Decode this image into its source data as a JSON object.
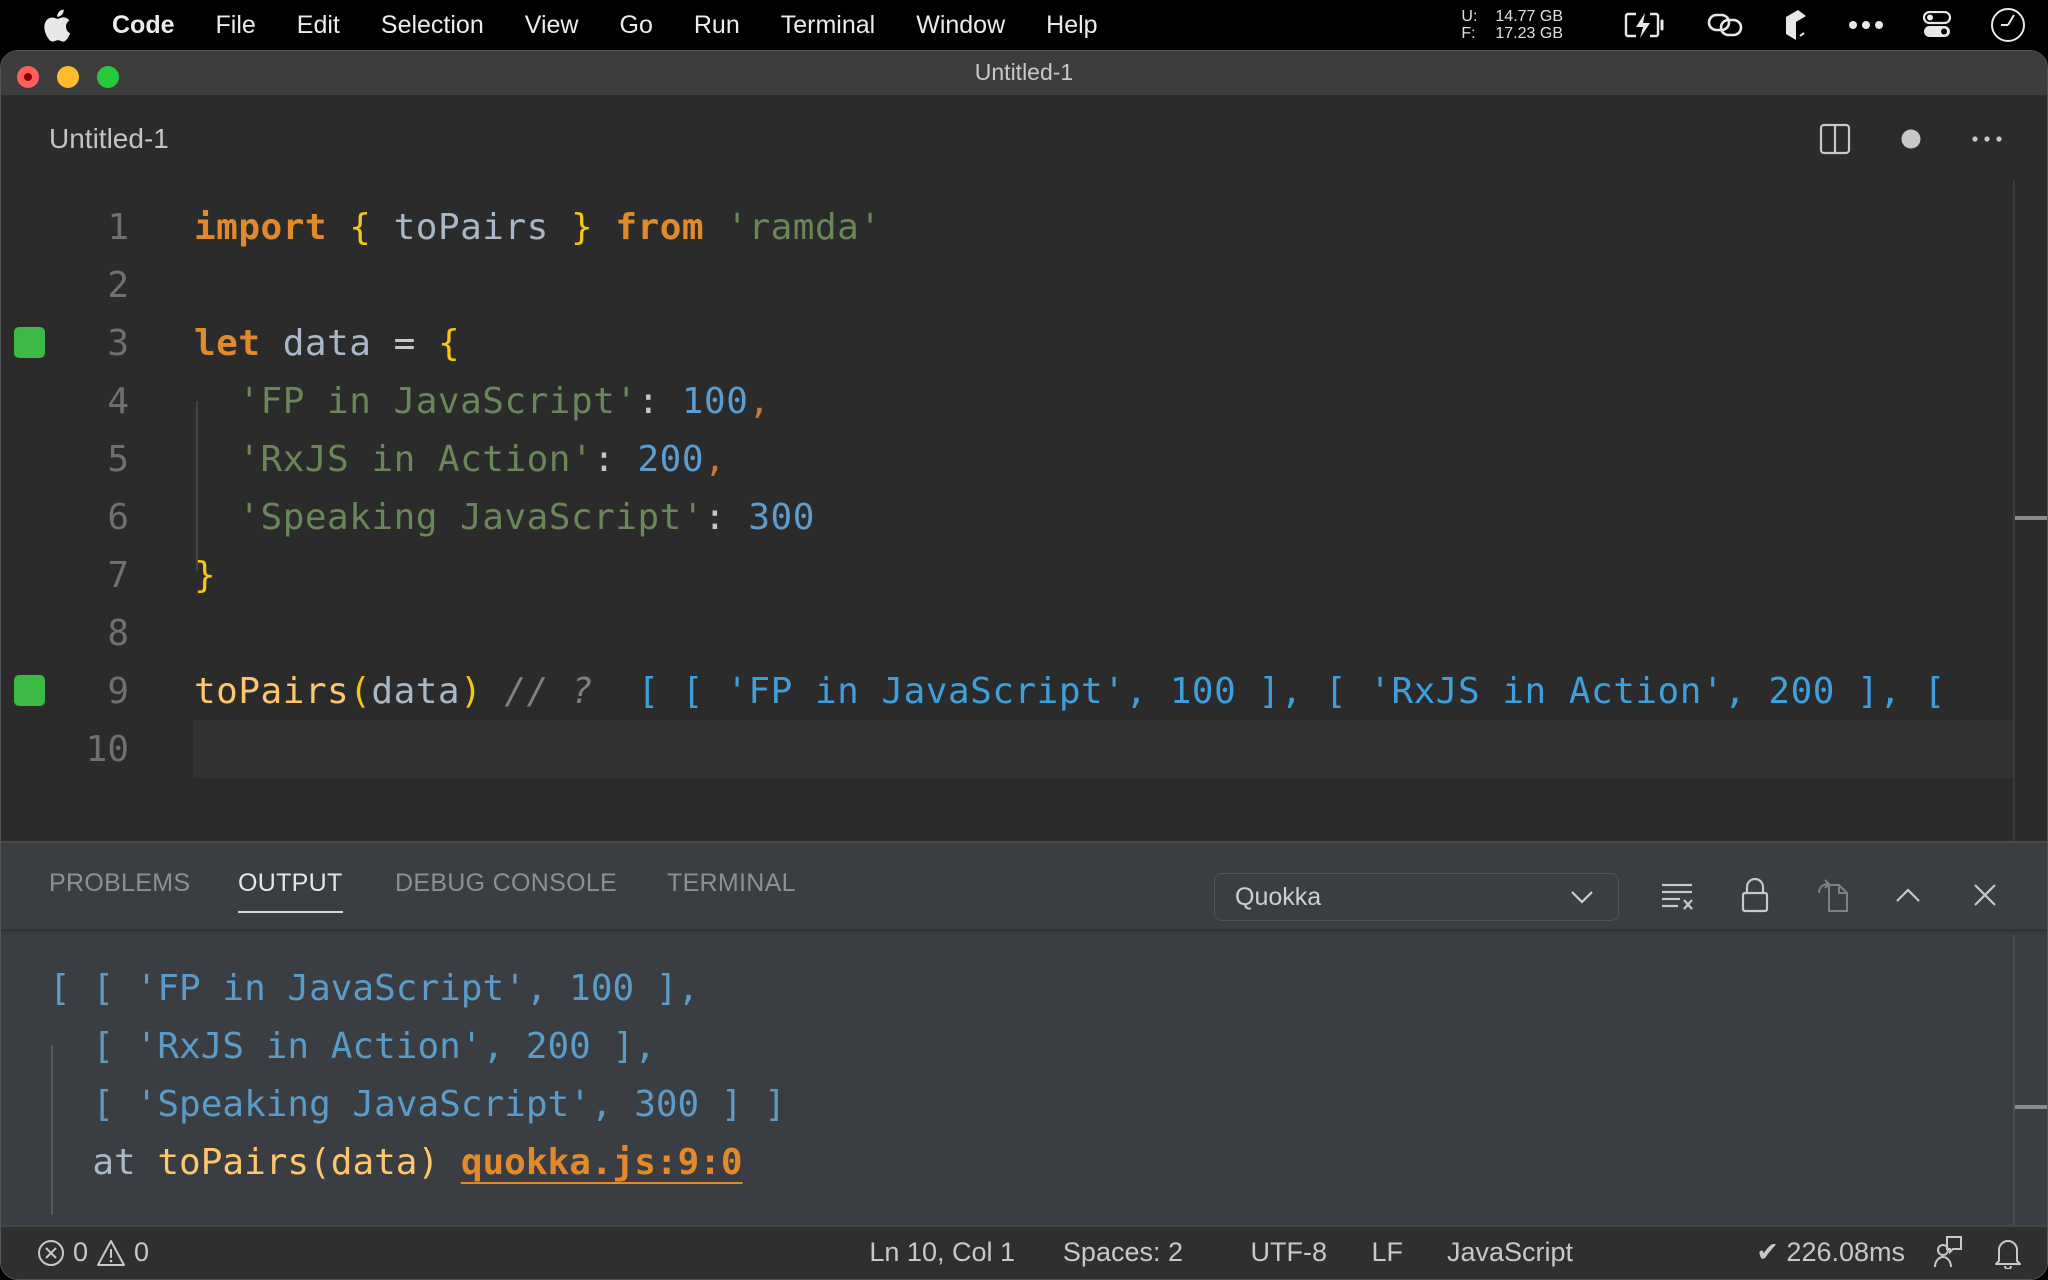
{
  "menubar": {
    "app_name": "Code",
    "items": [
      "File",
      "Edit",
      "Selection",
      "View",
      "Go",
      "Run",
      "Terminal",
      "Window",
      "Help"
    ],
    "memory": {
      "used_label": "U:",
      "used_value": "14.77 GB",
      "free_label": "F:",
      "free_value": "17.23 GB"
    },
    "status_icons": [
      "battery-charging-icon",
      "link-icon",
      "package-icon",
      "more-icon",
      "control-center-icon",
      "clock-icon"
    ]
  },
  "window": {
    "title": "Untitled-1"
  },
  "editor_tab": {
    "title": "Untitled-1",
    "actions": [
      "split-editor-icon",
      "unsaved-dot-icon",
      "more-actions-icon"
    ]
  },
  "editor": {
    "lines": [
      {
        "number": "1",
        "tokens": [
          [
            "kw",
            "import"
          ],
          [
            "op",
            " "
          ],
          [
            "brace",
            "{"
          ],
          [
            "ident",
            " toPairs "
          ],
          [
            "brace",
            "}"
          ],
          [
            "op",
            " "
          ],
          [
            "kw",
            "from"
          ],
          [
            "op",
            " "
          ],
          [
            "str",
            "'ramda'"
          ]
        ]
      },
      {
        "number": "2",
        "tokens": []
      },
      {
        "number": "3",
        "marker": true,
        "tokens": [
          [
            "kw",
            "let"
          ],
          [
            "ident",
            " data "
          ],
          [
            "op",
            "="
          ],
          [
            "op",
            " "
          ],
          [
            "brace",
            "{"
          ]
        ]
      },
      {
        "number": "4",
        "tokens": [
          [
            "op",
            "  "
          ],
          [
            "str",
            "'FP in JavaScript'"
          ],
          [
            "op",
            ": "
          ],
          [
            "num",
            "100"
          ],
          [
            "punct",
            ","
          ]
        ]
      },
      {
        "number": "5",
        "tokens": [
          [
            "op",
            "  "
          ],
          [
            "str",
            "'RxJS in Action'"
          ],
          [
            "op",
            ": "
          ],
          [
            "num",
            "200"
          ],
          [
            "punct",
            ","
          ]
        ]
      },
      {
        "number": "6",
        "tokens": [
          [
            "op",
            "  "
          ],
          [
            "str",
            "'Speaking JavaScript'"
          ],
          [
            "op",
            ": "
          ],
          [
            "num",
            "300"
          ]
        ]
      },
      {
        "number": "7",
        "tokens": [
          [
            "brace",
            "}"
          ]
        ]
      },
      {
        "number": "8",
        "tokens": []
      },
      {
        "number": "9",
        "marker": true,
        "tokens": [
          [
            "fn",
            "toPairs"
          ],
          [
            "brace",
            "("
          ],
          [
            "ident",
            "data"
          ],
          [
            "brace",
            ")"
          ],
          [
            "op",
            " "
          ],
          [
            "cmt",
            "// ?"
          ],
          [
            "op",
            "  "
          ],
          [
            "inline-val",
            "[ [ 'FP in JavaScript', 100 ], [ 'RxJS in Action', 200 ], ["
          ]
        ]
      },
      {
        "number": "10",
        "current": true,
        "tokens": []
      }
    ]
  },
  "panel": {
    "tabs": [
      {
        "label": "PROBLEMS",
        "active": false
      },
      {
        "label": "OUTPUT",
        "active": true
      },
      {
        "label": "DEBUG CONSOLE",
        "active": false
      },
      {
        "label": "TERMINAL",
        "active": false
      }
    ],
    "channel": "Quokka",
    "actions": [
      "clear-output-icon",
      "lock-scroll-icon",
      "open-in-editor-icon",
      "maximize-panel-icon",
      "close-panel-icon"
    ],
    "output_lines": [
      "[ [ 'FP in JavaScript', 100 ],",
      "  [ 'RxJS in Action', 200 ],",
      "  [ 'Speaking JavaScript', 300 ] ]"
    ],
    "output_at": {
      "prefix": "  at ",
      "expression": "toPairs(data)",
      "link": "quokka.js:9:0"
    }
  },
  "statusbar": {
    "errors": "0",
    "warnings": "0",
    "position": "Ln 10, Col 1",
    "indent": "Spaces: 2",
    "encoding": "UTF-8",
    "eol": "LF",
    "language": "JavaScript",
    "quokka_time": "✔ 226.08ms"
  },
  "colors": {
    "gutter_marker": "#3dba45",
    "keyword": "#e08a2c",
    "string": "#6a8759",
    "number": "#5d9ccf",
    "inline_value": "#3d9fdc",
    "link": "#e08a2c"
  }
}
